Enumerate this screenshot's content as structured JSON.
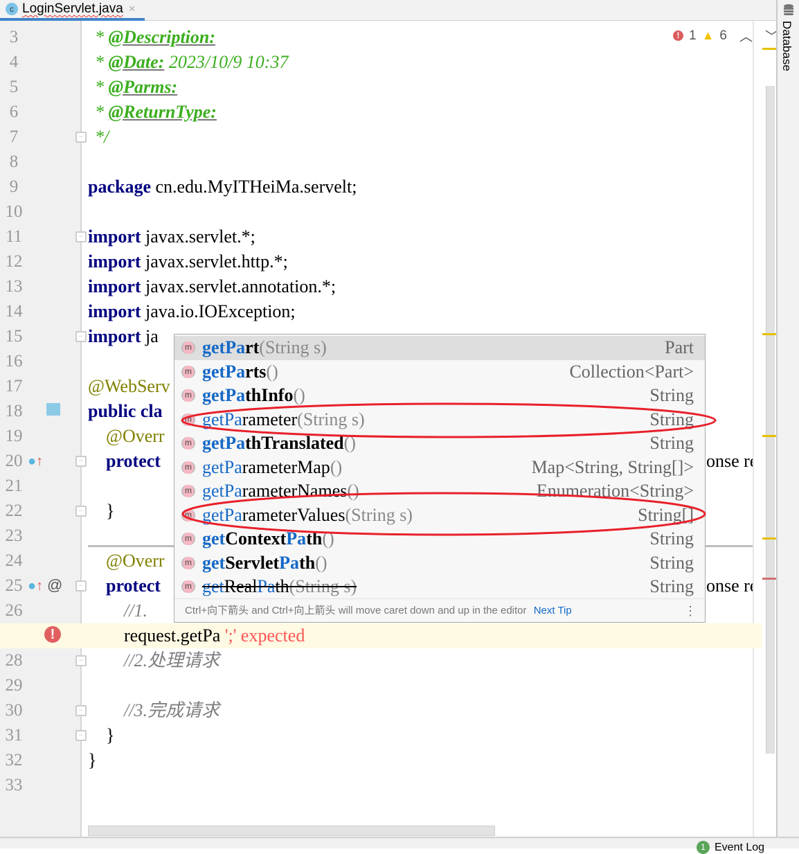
{
  "tab": {
    "icon": "class-icon",
    "icon_letter": "c",
    "title": "LoginServlet.java",
    "close": "×"
  },
  "inspections": {
    "errors": "1",
    "warnings": "6",
    "error_color": "#db5c5c",
    "warning_color": "#f0c400"
  },
  "right_panel": {
    "database_label": "Database"
  },
  "status_bar": {
    "event_log": "Event Log",
    "event_badge": "1"
  },
  "lines": [
    {
      "n": "3",
      "tokens": [
        {
          "t": "* ",
          "c": "doc"
        },
        {
          "t": "@Description:",
          "c": "doctag"
        }
      ]
    },
    {
      "n": "4",
      "tokens": [
        {
          "t": "* ",
          "c": "doc"
        },
        {
          "t": "@Date:",
          "c": "doctag"
        },
        {
          "t": " 2023/10/9 10:37",
          "c": "doc"
        }
      ]
    },
    {
      "n": "5",
      "tokens": [
        {
          "t": "* ",
          "c": "doc"
        },
        {
          "t": "@Parms:",
          "c": "doctag"
        }
      ]
    },
    {
      "n": "6",
      "tokens": [
        {
          "t": "* ",
          "c": "doc"
        },
        {
          "t": "@ReturnType:",
          "c": "doctag"
        }
      ]
    },
    {
      "n": "7",
      "tokens": [
        {
          "t": "*/",
          "c": "doc"
        }
      ]
    },
    {
      "n": "8",
      "tokens": []
    },
    {
      "n": "9",
      "tokens": [
        {
          "t": "package",
          "c": "kw"
        },
        {
          "t": " cn.edu.MyITHeiMa.servelt;",
          "c": "pl"
        }
      ]
    },
    {
      "n": "10",
      "tokens": []
    },
    {
      "n": "11",
      "tokens": [
        {
          "t": "import",
          "c": "kw"
        },
        {
          "t": " javax.servlet.*;",
          "c": "pl"
        }
      ]
    },
    {
      "n": "12",
      "tokens": [
        {
          "t": "import",
          "c": "kw"
        },
        {
          "t": " javax.servlet.http.*;",
          "c": "pl"
        }
      ]
    },
    {
      "n": "13",
      "tokens": [
        {
          "t": "import",
          "c": "kw"
        },
        {
          "t": " javax.servlet.annotation.*;",
          "c": "pl"
        }
      ]
    },
    {
      "n": "14",
      "tokens": [
        {
          "t": "import",
          "c": "kw"
        },
        {
          "t": " java.io.IOException;",
          "c": "pl"
        }
      ]
    },
    {
      "n": "15",
      "tokens": [
        {
          "t": "import",
          "c": "kw"
        },
        {
          "t": " ja",
          "c": "pl"
        }
      ]
    },
    {
      "n": "16",
      "tokens": []
    },
    {
      "n": "17",
      "tokens": [
        {
          "t": "@WebServ",
          "c": "ann"
        }
      ]
    },
    {
      "n": "18",
      "tokens": [
        {
          "t": "public cla",
          "c": "kw"
        }
      ]
    },
    {
      "n": "19",
      "tokens": [
        {
          "t": "    @Overr",
          "c": "ann"
        }
      ]
    },
    {
      "n": "20",
      "tokens": [
        {
          "t": "    protect",
          "c": "kw"
        }
      ],
      "right": "onse resp"
    },
    {
      "n": "21",
      "tokens": []
    },
    {
      "n": "22",
      "tokens": [
        {
          "t": "    }",
          "c": "pl"
        }
      ]
    },
    {
      "n": "23",
      "tokens": []
    },
    {
      "n": "24",
      "tokens": [
        {
          "t": "    @Overr",
          "c": "ann"
        }
      ]
    },
    {
      "n": "25",
      "tokens": [
        {
          "t": "    protect",
          "c": "kw"
        }
      ],
      "right": "onse res"
    },
    {
      "n": "26",
      "tokens": [
        {
          "t": "        //1.",
          "c": "cm"
        }
      ]
    },
    {
      "n": "27",
      "tokens": [
        {
          "t": "        request.getPa",
          "c": "pl"
        },
        {
          "t": " ';' expected",
          "c": "err"
        }
      ]
    },
    {
      "n": "28",
      "tokens": [
        {
          "t": "        //2.处理请求",
          "c": "cm"
        }
      ]
    },
    {
      "n": "29",
      "tokens": []
    },
    {
      "n": "30",
      "tokens": [
        {
          "t": "        //3.完成请求",
          "c": "cm"
        }
      ]
    },
    {
      "n": "31",
      "tokens": [
        {
          "t": "    }",
          "c": "pl"
        }
      ]
    },
    {
      "n": "32",
      "tokens": [
        {
          "t": "}",
          "c": "pl"
        }
      ]
    },
    {
      "n": "33",
      "tokens": []
    }
  ],
  "completion": {
    "items": [
      {
        "parts": [
          {
            "t": "getPa",
            "m": true
          },
          {
            "t": "rt",
            "m": false
          }
        ],
        "params": "(String s)",
        "type": "Part",
        "bold": true,
        "selected": true
      },
      {
        "parts": [
          {
            "t": "getPa",
            "m": true
          },
          {
            "t": "rts",
            "m": false
          }
        ],
        "params": "()",
        "type": "Collection<Part>",
        "bold": true
      },
      {
        "parts": [
          {
            "t": "getPa",
            "m": true
          },
          {
            "t": "thInfo",
            "m": false
          }
        ],
        "params": "()",
        "type": "String",
        "bold": true
      },
      {
        "parts": [
          {
            "t": "getPa",
            "m": true
          },
          {
            "t": "rameter",
            "m": false
          }
        ],
        "params": "(String s)",
        "type": "String",
        "bold": false,
        "circled": true
      },
      {
        "parts": [
          {
            "t": "getPa",
            "m": true
          },
          {
            "t": "thTranslated",
            "m": false
          }
        ],
        "params": "()",
        "type": "String",
        "bold": true
      },
      {
        "parts": [
          {
            "t": "getPa",
            "m": true
          },
          {
            "t": "rameterMap",
            "m": false
          }
        ],
        "params": "()",
        "type": "Map<String, String[]>",
        "bold": false
      },
      {
        "parts": [
          {
            "t": "getPa",
            "m": true
          },
          {
            "t": "rameterNames",
            "m": false
          }
        ],
        "params": "()",
        "type": "Enumeration<String>",
        "bold": false
      },
      {
        "parts": [
          {
            "t": "getPa",
            "m": true
          },
          {
            "t": "rameterValues",
            "m": false
          }
        ],
        "params": "(String s)",
        "type": "String[]",
        "bold": false,
        "circled": true
      },
      {
        "parts": [
          {
            "t": "get",
            "m": true
          },
          {
            "t": "Context",
            "m": false
          },
          {
            "t": "Pa",
            "m": true
          },
          {
            "t": "th",
            "m": false
          }
        ],
        "params": "()",
        "type": "String",
        "bold": true
      },
      {
        "parts": [
          {
            "t": "get",
            "m": true
          },
          {
            "t": "Servlet",
            "m": false
          },
          {
            "t": "Pa",
            "m": true
          },
          {
            "t": "th",
            "m": false
          }
        ],
        "params": "()",
        "type": "String",
        "bold": true
      },
      {
        "parts": [
          {
            "t": "get",
            "m": true
          },
          {
            "t": "Real",
            "m": false
          },
          {
            "t": "Pa",
            "m": true
          },
          {
            "t": "th",
            "m": false
          }
        ],
        "params": "(String s)",
        "type": "String",
        "bold": false,
        "deprecated": true
      }
    ],
    "item_icon": "method-icon",
    "item_icon_letter": "m",
    "tip": "Ctrl+向下箭头 and Ctrl+向上箭头 will move caret down and up in the editor",
    "next_tip": "Next Tip",
    "more": "⋮"
  },
  "annotation_color": "#e8202a"
}
